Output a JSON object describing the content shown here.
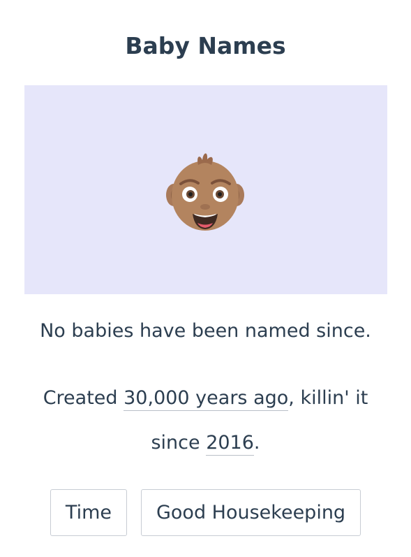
{
  "header": {
    "title": "Baby Names"
  },
  "hero": {
    "background": "#e6e6fa",
    "emoji": "baby-icon"
  },
  "content": {
    "summary": "No babies have been named since.",
    "created_prefix": "Created ",
    "created_link": "30,000 years ago",
    "created_middle": ", killin' it since ",
    "since_link": "2016",
    "created_suffix": "."
  },
  "tags": [
    {
      "label": "Time"
    },
    {
      "label": "Good Housekeeping"
    }
  ],
  "colors": {
    "text": "#2c3e50",
    "border": "#c7ccd3"
  }
}
